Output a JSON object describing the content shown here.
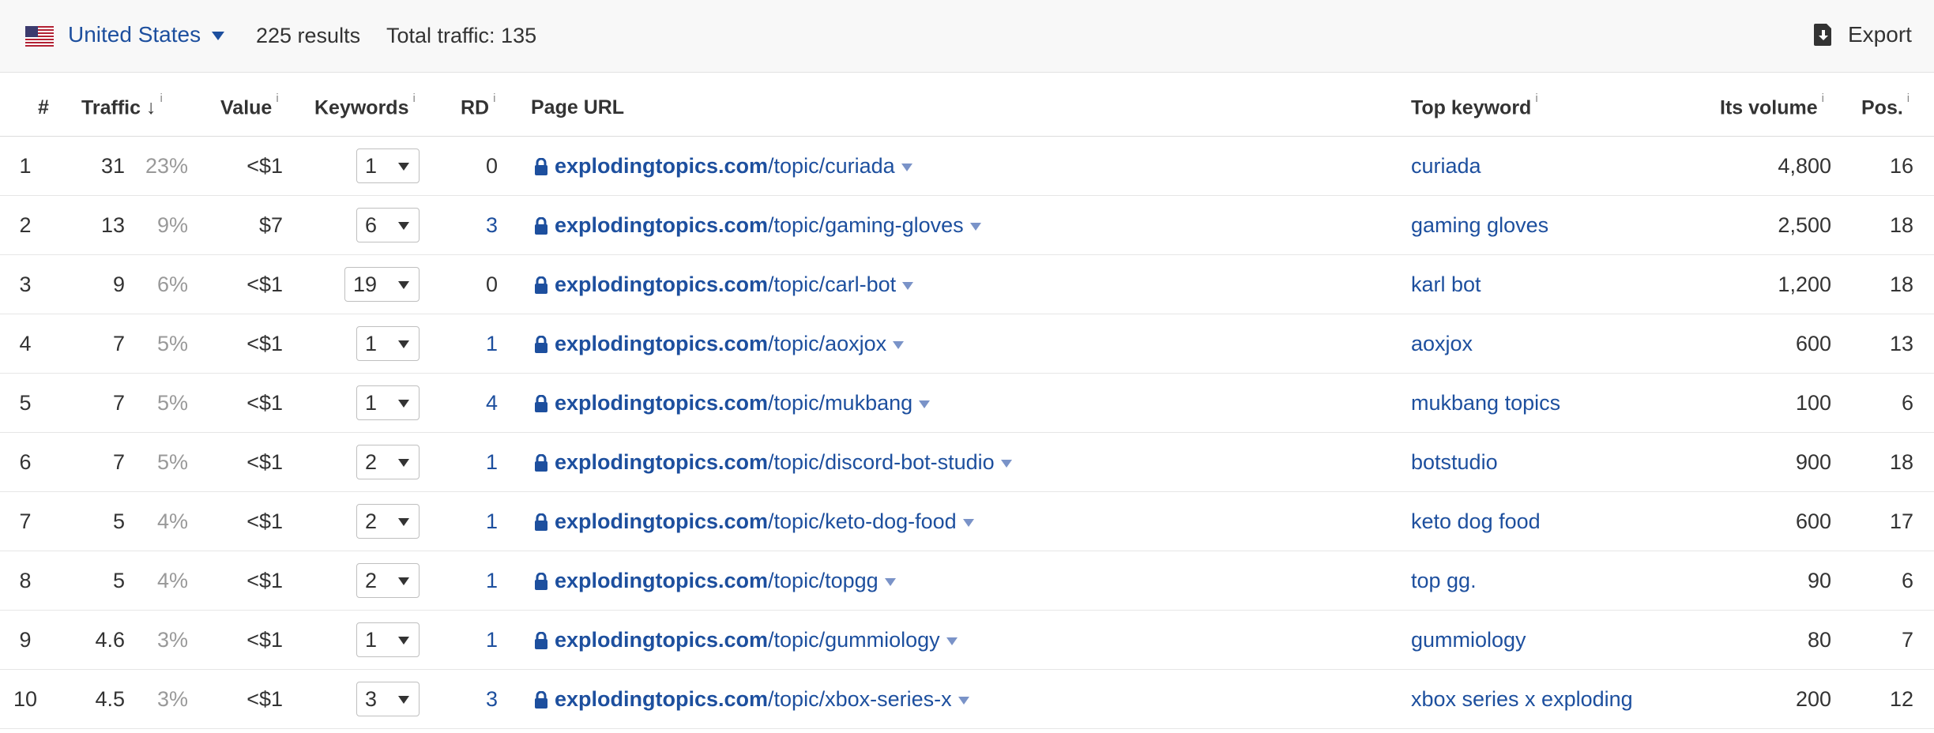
{
  "toolbar": {
    "country": "United States",
    "results": "225 results",
    "total_traffic": "Total traffic: 135",
    "export_label": "Export",
    "flag_icon": "us-flag-icon",
    "export_icon": "download-icon"
  },
  "columns": {
    "num": "#",
    "traffic": "Traffic",
    "value": "Value",
    "keywords": "Keywords",
    "rd": "RD",
    "page_url": "Page URL",
    "top_keyword": "Top keyword",
    "its_volume": "Its volume",
    "pos": "Pos.",
    "info_mark": "i",
    "sort_arrow": "↓"
  },
  "rows": [
    {
      "num": "1",
      "traffic": "31",
      "pct": "23%",
      "value": "<$1",
      "keywords": "1",
      "rd": "0",
      "domain": "explodingtopics.com",
      "path": "/topic/curiada",
      "top_keyword": "curiada",
      "volume": "4,800",
      "pos": "16"
    },
    {
      "num": "2",
      "traffic": "13",
      "pct": "9%",
      "value": "$7",
      "keywords": "6",
      "rd": "3",
      "domain": "explodingtopics.com",
      "path": "/topic/gaming-gloves",
      "top_keyword": "gaming gloves",
      "volume": "2,500",
      "pos": "18"
    },
    {
      "num": "3",
      "traffic": "9",
      "pct": "6%",
      "value": "<$1",
      "keywords": "19",
      "rd": "0",
      "domain": "explodingtopics.com",
      "path": "/topic/carl-bot",
      "top_keyword": "karl bot",
      "volume": "1,200",
      "pos": "18"
    },
    {
      "num": "4",
      "traffic": "7",
      "pct": "5%",
      "value": "<$1",
      "keywords": "1",
      "rd": "1",
      "domain": "explodingtopics.com",
      "path": "/topic/aoxjox",
      "top_keyword": "aoxjox",
      "volume": "600",
      "pos": "13"
    },
    {
      "num": "5",
      "traffic": "7",
      "pct": "5%",
      "value": "<$1",
      "keywords": "1",
      "rd": "4",
      "domain": "explodingtopics.com",
      "path": "/topic/mukbang",
      "top_keyword": "mukbang topics",
      "volume": "100",
      "pos": "6"
    },
    {
      "num": "6",
      "traffic": "7",
      "pct": "5%",
      "value": "<$1",
      "keywords": "2",
      "rd": "1",
      "domain": "explodingtopics.com",
      "path": "/topic/discord-bot-studio",
      "top_keyword": "botstudio",
      "volume": "900",
      "pos": "18"
    },
    {
      "num": "7",
      "traffic": "5",
      "pct": "4%",
      "value": "<$1",
      "keywords": "2",
      "rd": "1",
      "domain": "explodingtopics.com",
      "path": "/topic/keto-dog-food",
      "top_keyword": "keto dog food",
      "volume": "600",
      "pos": "17"
    },
    {
      "num": "8",
      "traffic": "5",
      "pct": "4%",
      "value": "<$1",
      "keywords": "2",
      "rd": "1",
      "domain": "explodingtopics.com",
      "path": "/topic/topgg",
      "top_keyword": "top gg.",
      "volume": "90",
      "pos": "6"
    },
    {
      "num": "9",
      "traffic": "4.6",
      "pct": "3%",
      "value": "<$1",
      "keywords": "1",
      "rd": "1",
      "domain": "explodingtopics.com",
      "path": "/topic/gummiology",
      "top_keyword": "gummiology",
      "volume": "80",
      "pos": "7"
    },
    {
      "num": "10",
      "traffic": "4.5",
      "pct": "3%",
      "value": "<$1",
      "keywords": "3",
      "rd": "3",
      "domain": "explodingtopics.com",
      "path": "/topic/xbox-series-x",
      "top_keyword": "xbox series x exploding",
      "volume": "200",
      "pos": "12"
    }
  ],
  "colors": {
    "link": "#1d4f9e",
    "muted": "#999999",
    "toolbar_bg": "#f8f8f8"
  }
}
